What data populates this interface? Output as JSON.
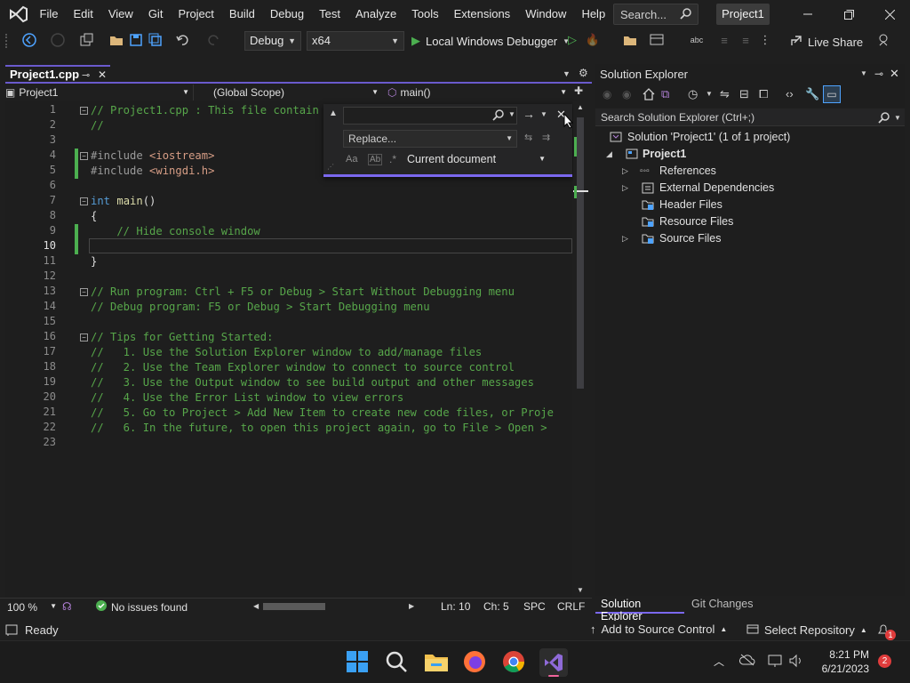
{
  "menu": [
    "File",
    "Edit",
    "View",
    "Git",
    "Project",
    "Build",
    "Debug",
    "Test",
    "Analyze",
    "Tools",
    "Extensions",
    "Window",
    "Help"
  ],
  "search_placeholder": "Search...",
  "project_badge": "Project1",
  "toolbar": {
    "config": "Debug",
    "platform": "x64",
    "debugger": "Local Windows Debugger",
    "live_share": "Live Share"
  },
  "doc_tab": "Project1.cpp",
  "nav": {
    "project": "Project1",
    "scope": "(Global Scope)",
    "member": "main()"
  },
  "line_numbers": [
    "1",
    "2",
    "3",
    "4",
    "5",
    "6",
    "7",
    "8",
    "9",
    "10",
    "11",
    "12",
    "13",
    "14",
    "15",
    "16",
    "17",
    "18",
    "19",
    "20",
    "21",
    "22",
    "23"
  ],
  "code": {
    "l1": "// Project1.cpp : This file contain",
    "l2": "//",
    "l4_kw": "#include ",
    "l4_str": "<iostream>",
    "l5_kw": "#include ",
    "l5_str": "<wingdi.h>",
    "l7_kw": "int ",
    "l7_fn": "main",
    "l7_rest": "()",
    "l8": "{",
    "l9": "    // Hide console window",
    "l11": "}",
    "l13": "// Run program: Ctrl + F5 or Debug > Start Without Debugging menu",
    "l14": "// Debug program: F5 or Debug > Start Debugging menu",
    "l16": "// Tips for Getting Started:",
    "l17": "//   1. Use the Solution Explorer window to add/manage files",
    "l18": "//   2. Use the Team Explorer window to connect to source control",
    "l19": "//   3. Use the Output window to see build output and other messages",
    "l20": "//   4. Use the Error List window to view errors",
    "l21": "//   5. Go to Project > Add New Item to create new code files, or Proje",
    "l22": "//   6. In the future, to open this project again, go to File > Open > "
  },
  "find_widget": {
    "find_value": "",
    "replace_placeholder": "Replace...",
    "scope": "Current document"
  },
  "editor_status": {
    "zoom": "100 %",
    "issues": "No issues found",
    "ln": "Ln: 10",
    "ch": "Ch: 5",
    "spc": "SPC",
    "eol": "CRLF"
  },
  "solution_explorer": {
    "title": "Solution Explorer",
    "search_placeholder": "Search Solution Explorer (Ctrl+;)",
    "solution": "Solution 'Project1' (1 of 1 project)",
    "project": "Project1",
    "items": [
      "References",
      "External Dependencies",
      "Header Files",
      "Resource Files",
      "Source Files"
    ],
    "tabs": [
      "Solution Explorer",
      "Git Changes"
    ]
  },
  "status": {
    "ready": "Ready",
    "add_source": "Add to Source Control",
    "select_repo": "Select Repository",
    "notif_count": "1"
  },
  "taskbar": {
    "time": "8:21 PM",
    "date": "6/21/2023",
    "badge": "2"
  },
  "colors": {
    "accent": "#7b68ee",
    "comment": "#57a64a",
    "keyword": "#569cd6",
    "string": "#d69d85",
    "changed": "#4caf50"
  }
}
